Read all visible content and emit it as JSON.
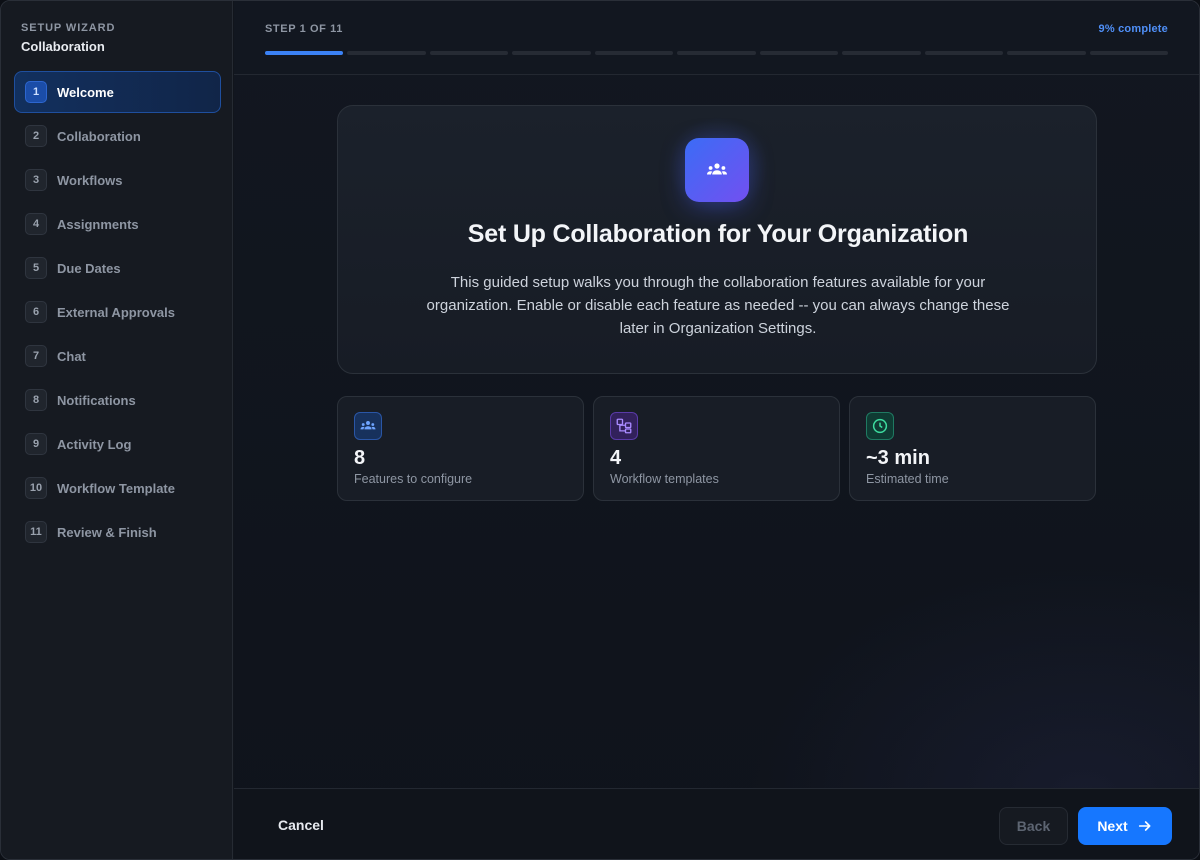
{
  "sidebar": {
    "eyebrow": "SETUP WIZARD",
    "title": "Collaboration",
    "items": [
      {
        "num": "1",
        "label": "Welcome",
        "active": true
      },
      {
        "num": "2",
        "label": "Collaboration"
      },
      {
        "num": "3",
        "label": "Workflows"
      },
      {
        "num": "4",
        "label": "Assignments"
      },
      {
        "num": "5",
        "label": "Due Dates"
      },
      {
        "num": "6",
        "label": "External Approvals"
      },
      {
        "num": "7",
        "label": "Chat"
      },
      {
        "num": "8",
        "label": "Notifications"
      },
      {
        "num": "9",
        "label": "Activity Log"
      },
      {
        "num": "10",
        "label": "Workflow Template"
      },
      {
        "num": "11",
        "label": "Review & Finish"
      }
    ]
  },
  "header": {
    "step_label": "STEP 1 OF 11",
    "percent_label": "9% complete",
    "progress": {
      "current_step": 1,
      "total_steps": 11
    }
  },
  "hero": {
    "icon": "group-icon",
    "title": "Set Up Collaboration for Your Organization",
    "description": "This guided setup walks you through the collaboration features available for your organization. Enable or disable each feature as needed -- you can always change these later in Organization Settings."
  },
  "stats": [
    {
      "icon": "group-icon",
      "value": "8",
      "label": "Features to configure"
    },
    {
      "icon": "workflow-icon",
      "value": "4",
      "label": "Workflow templates"
    },
    {
      "icon": "clock-icon",
      "value": "~3 min",
      "label": "Estimated time"
    }
  ],
  "footer": {
    "cancel_label": "Cancel",
    "back_label": "Back",
    "next_label": "Next"
  },
  "colors": {
    "accent": "#1677ff",
    "progress_done": "#3b82f6",
    "percent_text": "#4f8ff7",
    "icon_gradient_start": "#3b6cf6",
    "icon_gradient_end": "#7250f0"
  }
}
